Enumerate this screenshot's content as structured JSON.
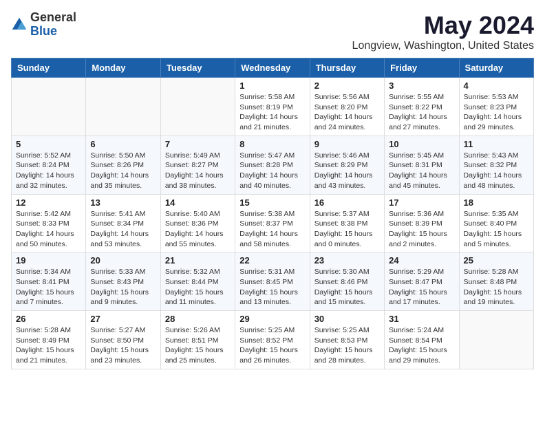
{
  "logo": {
    "general": "General",
    "blue": "Blue"
  },
  "title": "May 2024",
  "location": "Longview, Washington, United States",
  "days_of_week": [
    "Sunday",
    "Monday",
    "Tuesday",
    "Wednesday",
    "Thursday",
    "Friday",
    "Saturday"
  ],
  "weeks": [
    [
      {
        "day": "",
        "info": ""
      },
      {
        "day": "",
        "info": ""
      },
      {
        "day": "",
        "info": ""
      },
      {
        "day": "1",
        "info": "Sunrise: 5:58 AM\nSunset: 8:19 PM\nDaylight: 14 hours\nand 21 minutes."
      },
      {
        "day": "2",
        "info": "Sunrise: 5:56 AM\nSunset: 8:20 PM\nDaylight: 14 hours\nand 24 minutes."
      },
      {
        "day": "3",
        "info": "Sunrise: 5:55 AM\nSunset: 8:22 PM\nDaylight: 14 hours\nand 27 minutes."
      },
      {
        "day": "4",
        "info": "Sunrise: 5:53 AM\nSunset: 8:23 PM\nDaylight: 14 hours\nand 29 minutes."
      }
    ],
    [
      {
        "day": "5",
        "info": "Sunrise: 5:52 AM\nSunset: 8:24 PM\nDaylight: 14 hours\nand 32 minutes."
      },
      {
        "day": "6",
        "info": "Sunrise: 5:50 AM\nSunset: 8:26 PM\nDaylight: 14 hours\nand 35 minutes."
      },
      {
        "day": "7",
        "info": "Sunrise: 5:49 AM\nSunset: 8:27 PM\nDaylight: 14 hours\nand 38 minutes."
      },
      {
        "day": "8",
        "info": "Sunrise: 5:47 AM\nSunset: 8:28 PM\nDaylight: 14 hours\nand 40 minutes."
      },
      {
        "day": "9",
        "info": "Sunrise: 5:46 AM\nSunset: 8:29 PM\nDaylight: 14 hours\nand 43 minutes."
      },
      {
        "day": "10",
        "info": "Sunrise: 5:45 AM\nSunset: 8:31 PM\nDaylight: 14 hours\nand 45 minutes."
      },
      {
        "day": "11",
        "info": "Sunrise: 5:43 AM\nSunset: 8:32 PM\nDaylight: 14 hours\nand 48 minutes."
      }
    ],
    [
      {
        "day": "12",
        "info": "Sunrise: 5:42 AM\nSunset: 8:33 PM\nDaylight: 14 hours\nand 50 minutes."
      },
      {
        "day": "13",
        "info": "Sunrise: 5:41 AM\nSunset: 8:34 PM\nDaylight: 14 hours\nand 53 minutes."
      },
      {
        "day": "14",
        "info": "Sunrise: 5:40 AM\nSunset: 8:36 PM\nDaylight: 14 hours\nand 55 minutes."
      },
      {
        "day": "15",
        "info": "Sunrise: 5:38 AM\nSunset: 8:37 PM\nDaylight: 14 hours\nand 58 minutes."
      },
      {
        "day": "16",
        "info": "Sunrise: 5:37 AM\nSunset: 8:38 PM\nDaylight: 15 hours\nand 0 minutes."
      },
      {
        "day": "17",
        "info": "Sunrise: 5:36 AM\nSunset: 8:39 PM\nDaylight: 15 hours\nand 2 minutes."
      },
      {
        "day": "18",
        "info": "Sunrise: 5:35 AM\nSunset: 8:40 PM\nDaylight: 15 hours\nand 5 minutes."
      }
    ],
    [
      {
        "day": "19",
        "info": "Sunrise: 5:34 AM\nSunset: 8:41 PM\nDaylight: 15 hours\nand 7 minutes."
      },
      {
        "day": "20",
        "info": "Sunrise: 5:33 AM\nSunset: 8:43 PM\nDaylight: 15 hours\nand 9 minutes."
      },
      {
        "day": "21",
        "info": "Sunrise: 5:32 AM\nSunset: 8:44 PM\nDaylight: 15 hours\nand 11 minutes."
      },
      {
        "day": "22",
        "info": "Sunrise: 5:31 AM\nSunset: 8:45 PM\nDaylight: 15 hours\nand 13 minutes."
      },
      {
        "day": "23",
        "info": "Sunrise: 5:30 AM\nSunset: 8:46 PM\nDaylight: 15 hours\nand 15 minutes."
      },
      {
        "day": "24",
        "info": "Sunrise: 5:29 AM\nSunset: 8:47 PM\nDaylight: 15 hours\nand 17 minutes."
      },
      {
        "day": "25",
        "info": "Sunrise: 5:28 AM\nSunset: 8:48 PM\nDaylight: 15 hours\nand 19 minutes."
      }
    ],
    [
      {
        "day": "26",
        "info": "Sunrise: 5:28 AM\nSunset: 8:49 PM\nDaylight: 15 hours\nand 21 minutes."
      },
      {
        "day": "27",
        "info": "Sunrise: 5:27 AM\nSunset: 8:50 PM\nDaylight: 15 hours\nand 23 minutes."
      },
      {
        "day": "28",
        "info": "Sunrise: 5:26 AM\nSunset: 8:51 PM\nDaylight: 15 hours\nand 25 minutes."
      },
      {
        "day": "29",
        "info": "Sunrise: 5:25 AM\nSunset: 8:52 PM\nDaylight: 15 hours\nand 26 minutes."
      },
      {
        "day": "30",
        "info": "Sunrise: 5:25 AM\nSunset: 8:53 PM\nDaylight: 15 hours\nand 28 minutes."
      },
      {
        "day": "31",
        "info": "Sunrise: 5:24 AM\nSunset: 8:54 PM\nDaylight: 15 hours\nand 29 minutes."
      },
      {
        "day": "",
        "info": ""
      }
    ]
  ]
}
